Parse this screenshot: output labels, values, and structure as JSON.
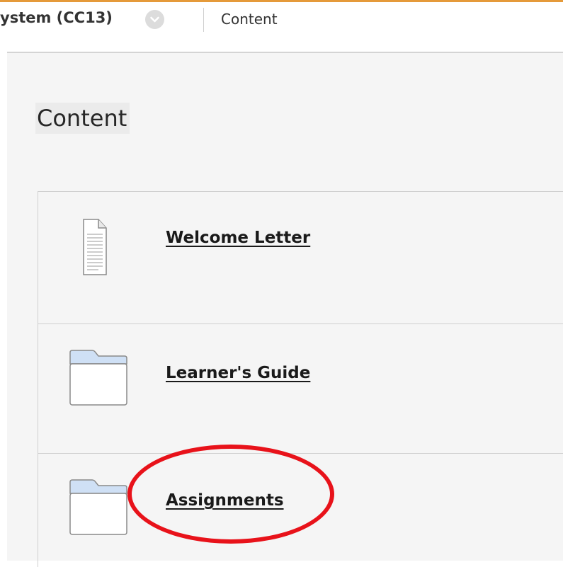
{
  "breadcrumb": {
    "course": "ystem (CC13)",
    "current": "Content"
  },
  "page": {
    "title": "Content"
  },
  "items": [
    {
      "label": "Welcome Letter",
      "icon": "document-icon"
    },
    {
      "label": "Learner's Guide",
      "icon": "folder-icon"
    },
    {
      "label": "Assignments",
      "icon": "folder-icon"
    }
  ],
  "annotation": {
    "color": "#e8121a",
    "target": "Assignments"
  },
  "colors": {
    "accent": "#e59a3a",
    "folder_tab": "#cfe0f5"
  }
}
